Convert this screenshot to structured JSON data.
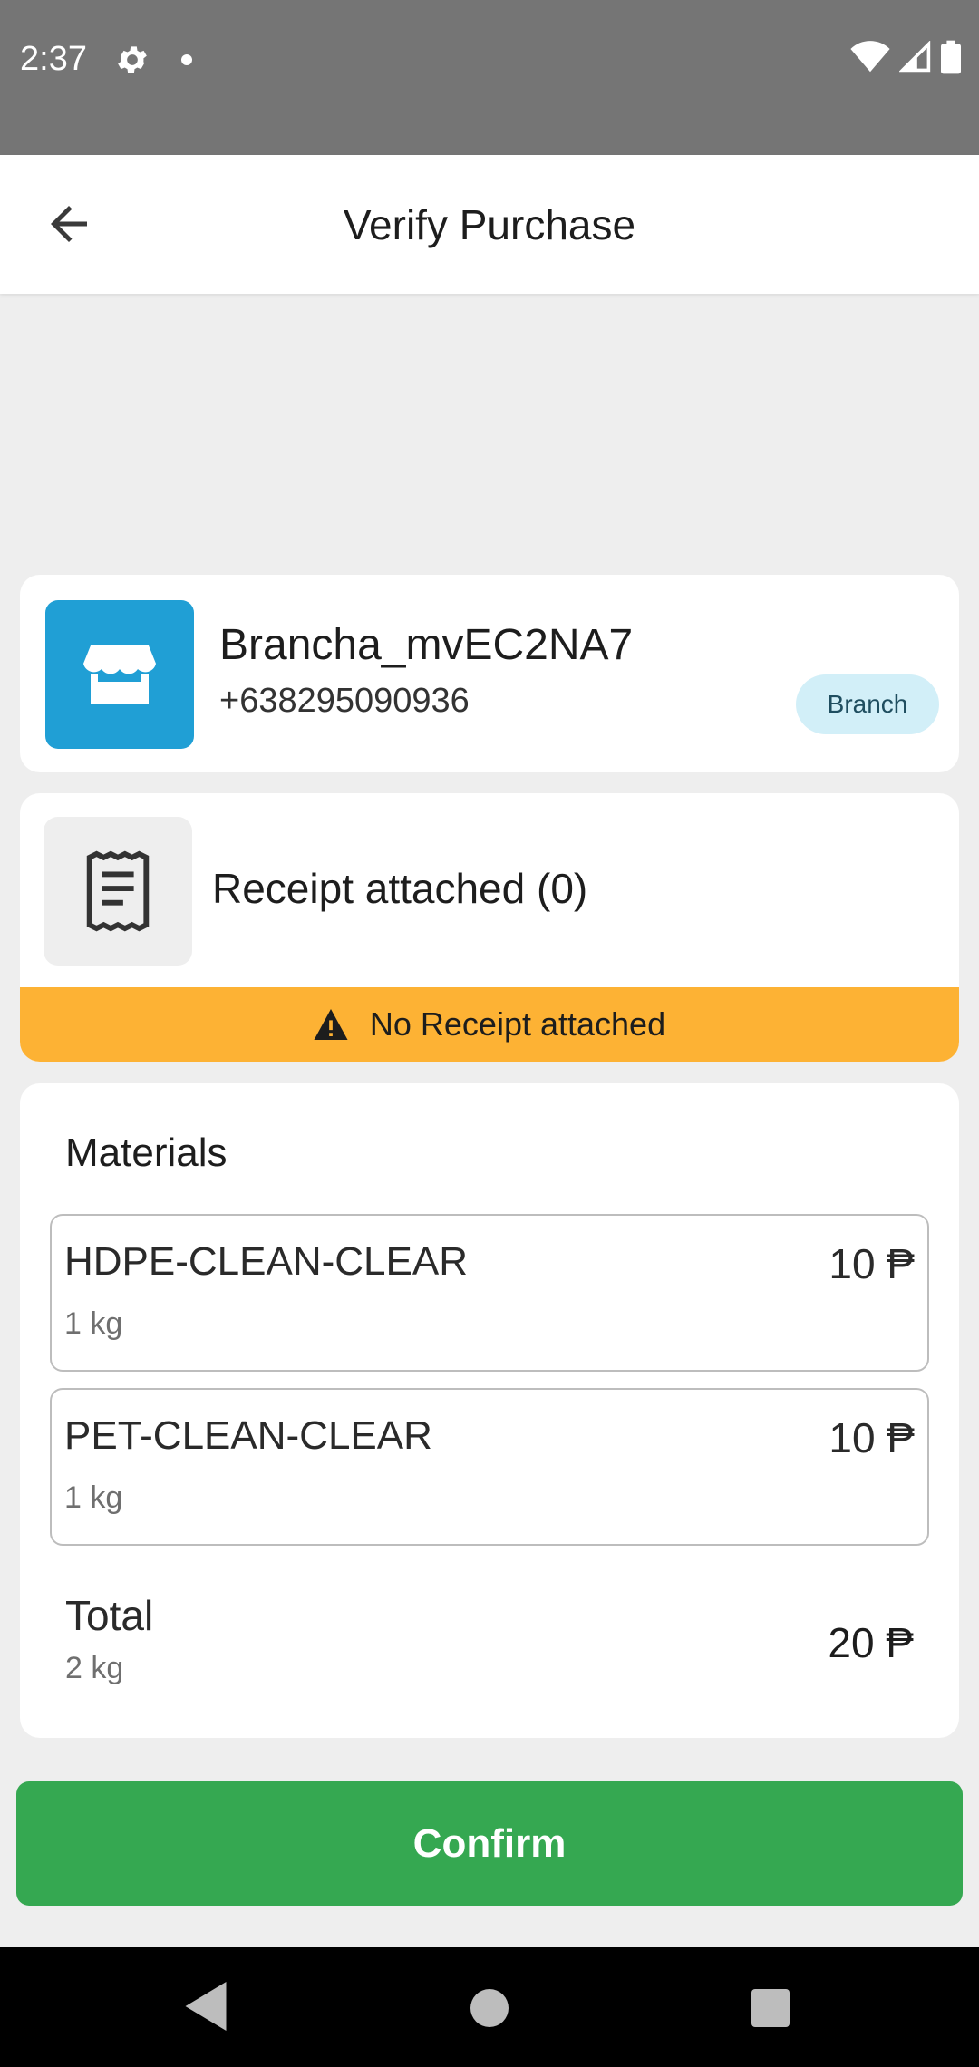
{
  "status_bar": {
    "time": "2:37",
    "icons": [
      "gear-icon",
      "dot-icon",
      "wifi-icon",
      "signal-icon",
      "battery-icon"
    ]
  },
  "app_bar": {
    "title": "Verify Purchase",
    "back_icon": "arrow-left-icon"
  },
  "branch": {
    "name": "Brancha_mvEC2NA7",
    "phone": "+638295090936",
    "badge": "Branch",
    "icon": "store-icon",
    "icon_bg": "#209fd5",
    "badge_bg": "#d2eff8"
  },
  "receipt": {
    "label": "Receipt attached (0)",
    "warning": "No Receipt attached",
    "icon": "receipt-icon",
    "warning_icon": "warning-icon",
    "warning_color": "#fdb234"
  },
  "materials": {
    "title": "Materials",
    "items": [
      {
        "name": "HDPE-CLEAN-CLEAR",
        "qty": "1 kg",
        "price": "10 ₱"
      },
      {
        "name": "PET-CLEAN-CLEAR",
        "qty": "1 kg",
        "price": "10 ₱"
      }
    ],
    "total_label": "Total",
    "total_qty": "2 kg",
    "total_price": "20 ₱"
  },
  "actions": {
    "confirm_label": "Confirm",
    "confirm_color": "#35a851"
  },
  "nav_bar": {
    "icons": [
      "nav-back-icon",
      "nav-home-icon",
      "nav-recents-icon"
    ]
  }
}
